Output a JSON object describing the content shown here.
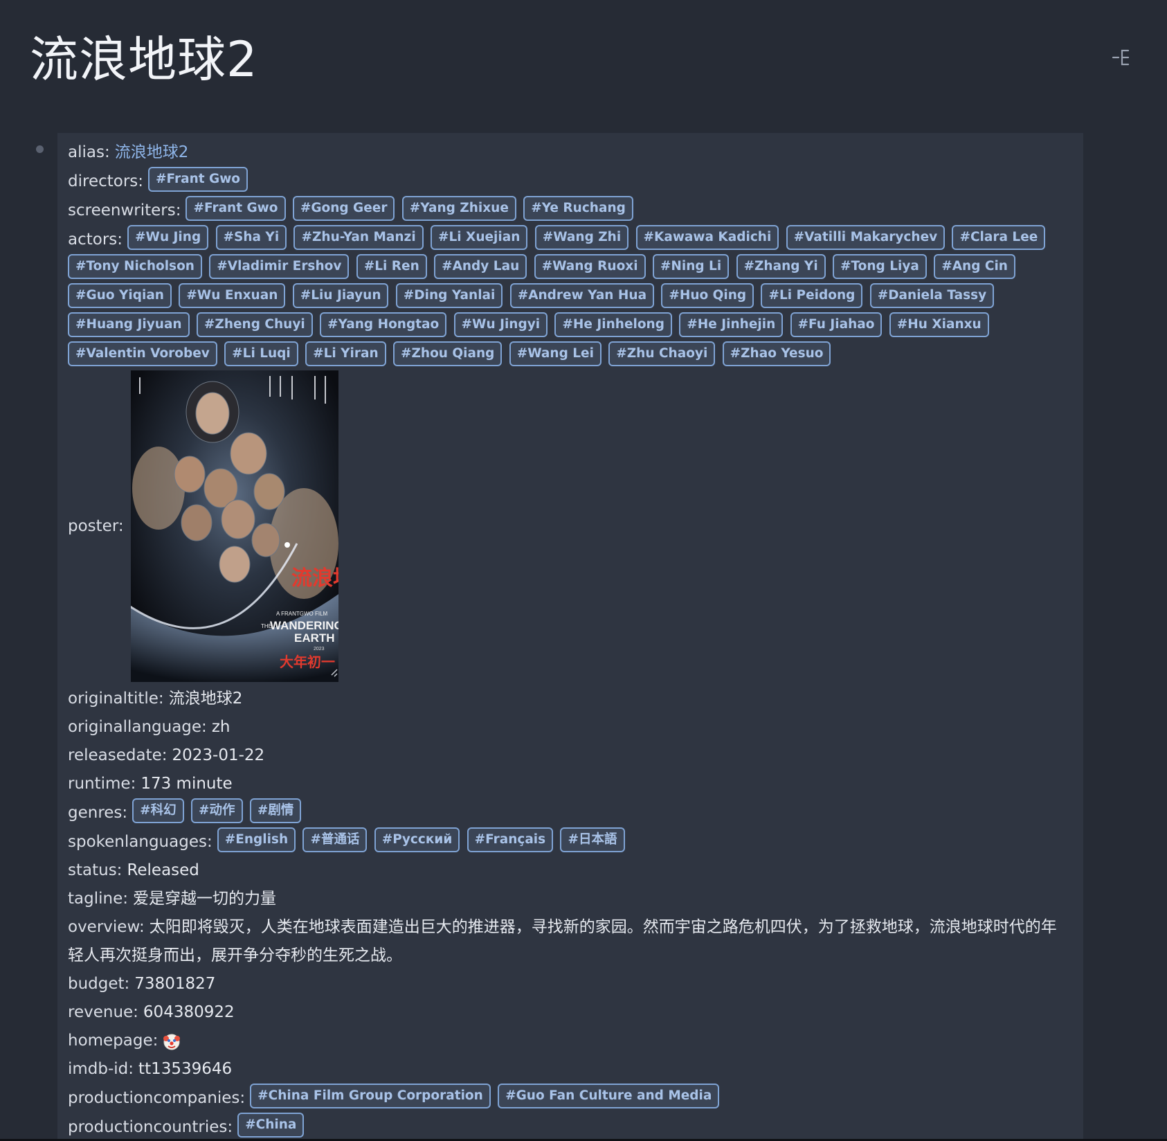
{
  "page": {
    "title": "流浪地球2"
  },
  "properties": {
    "alias": {
      "key": "alias:",
      "value": "流浪地球2"
    },
    "directors": {
      "key": "directors:",
      "tags": [
        "#Frant Gwo"
      ]
    },
    "screenwriters": {
      "key": "screenwriters:",
      "tags": [
        "#Frant Gwo",
        "#Gong Geer",
        "#Yang Zhixue",
        "#Ye Ruchang"
      ]
    },
    "actors": {
      "key": "actors:",
      "tags": [
        "#Wu Jing",
        "#Sha Yi",
        "#Zhu-Yan Manzi",
        "#Li Xuejian",
        "#Wang Zhi",
        "#Kawawa Kadichi",
        "#Vatilli Makarychev",
        "#Clara Lee",
        "#Tony Nicholson",
        "#Vladimir Ershov",
        "#Li Ren",
        "#Andy Lau",
        "#Wang Ruoxi",
        "#Ning Li",
        "#Zhang Yi",
        "#Tong Liya",
        "#Ang Cin",
        "#Guo Yiqian",
        "#Wu Enxuan",
        "#Liu Jiayun",
        "#Ding Yanlai",
        "#Andrew Yan Hua",
        "#Huo Qing",
        "#Li Peidong",
        "#Daniela Tassy",
        "#Huang Jiyuan",
        "#Zheng Chuyi",
        "#Yang Hongtao",
        "#Wu Jingyi",
        "#He Jinhelong",
        "#He Jinhejin",
        "#Fu Jiahao",
        "#Hu Xianxu",
        "#Valentin Vorobev",
        "#Li Luqi",
        "#Li Yiran",
        "#Zhou Qiang",
        "#Wang Lei",
        "#Zhu Chaoyi",
        "#Zhao Yesuo"
      ]
    },
    "poster": {
      "key": "poster:",
      "text_small": "A FRANTGWO FILM",
      "text_the": "THE",
      "text_title1": "WANDERING",
      "text_title2": "EARTH",
      "text_year": "2023",
      "text_cn": "流浪地球",
      "text_date": "大年初一"
    },
    "originaltitle": {
      "key": "originaltitle:",
      "value": "流浪地球2"
    },
    "originallanguage": {
      "key": "originallanguage:",
      "value": "zh"
    },
    "releasedate": {
      "key": "releasedate:",
      "value": "2023-01-22"
    },
    "runtime": {
      "key": "runtime:",
      "value": "173 minute"
    },
    "genres": {
      "key": "genres:",
      "tags": [
        "#科幻",
        "#动作",
        "#剧情"
      ]
    },
    "spokenlanguages": {
      "key": "spokenlanguages:",
      "tags": [
        "#English",
        "#普通话",
        "#Pусский",
        "#Français",
        "#日本語"
      ]
    },
    "status": {
      "key": "status:",
      "value": "Released"
    },
    "tagline": {
      "key": "tagline:",
      "value": "爱是穿越一切的力量"
    },
    "overview": {
      "key": "overview:",
      "value": "太阳即将毁灭，人类在地球表面建造出巨大的推进器，寻找新的家园。然而宇宙之路危机四伏，为了拯救地球，流浪地球时代的年轻人再次挺身而出，展开争分夺秒的生死之战。"
    },
    "budget": {
      "key": "budget:",
      "value": "73801827"
    },
    "revenue": {
      "key": "revenue:",
      "value": "604380922"
    },
    "homepage": {
      "key": "homepage:",
      "icon": "clown-face-icon"
    },
    "imdbid": {
      "key": "imdb-id:",
      "value": "tt13539646"
    },
    "productioncompanies": {
      "key": "productioncompanies:",
      "tags": [
        "#China Film Group Corporation",
        "#Guo Fan Culture and Media"
      ]
    },
    "productioncountries": {
      "key": "productioncountries:",
      "tags": [
        "#China"
      ]
    }
  },
  "icons": {
    "outline": "outline-tree-icon",
    "bullet": "bullet-dot-icon"
  },
  "colors": {
    "background": "#262b35",
    "block": "#2f3541",
    "tag_border": "#7fa3d4",
    "tag_text": "#a9c3e8",
    "link": "#8fb6ea"
  }
}
